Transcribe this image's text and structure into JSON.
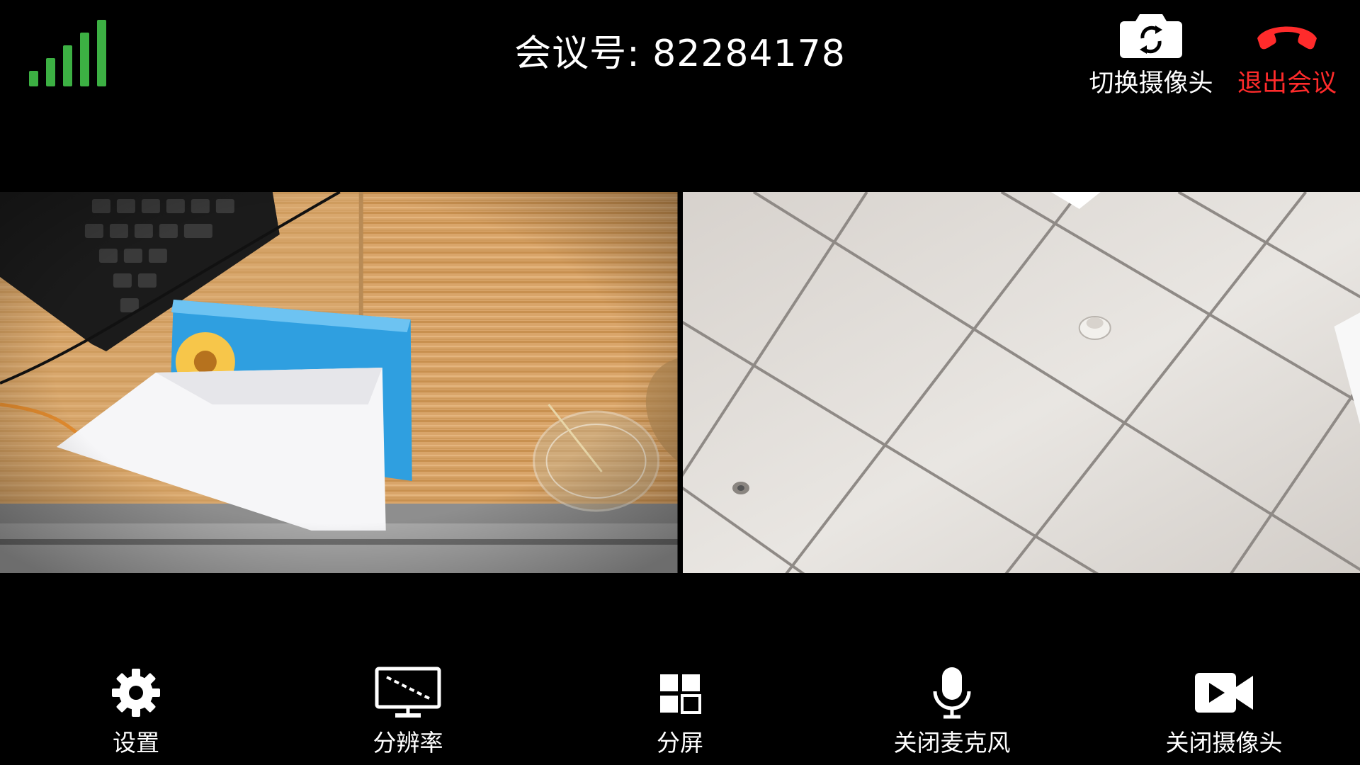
{
  "meeting": {
    "label": "会议号",
    "separator": ":",
    "number": "82284178",
    "display": "会议号: 82284178"
  },
  "signal": {
    "icon": "signal-strength-icon",
    "bars": 5,
    "color": "#3cb043"
  },
  "top_actions": {
    "switch_camera": {
      "label": "切换摄像头",
      "icon": "camera-switch-icon"
    },
    "leave_meeting": {
      "label": "退出会议",
      "icon": "hang-up-icon",
      "color": "#ff2b2b"
    }
  },
  "videos": [
    {
      "name": "local-video",
      "description_icon": "video-feed"
    },
    {
      "name": "remote-video",
      "description_icon": "video-feed"
    }
  ],
  "toolbar": {
    "settings": {
      "label": "设置",
      "icon": "gear-icon"
    },
    "resolution": {
      "label": "分辨率",
      "icon": "monitor-icon"
    },
    "split_screen": {
      "label": "分屏",
      "icon": "grid-icon"
    },
    "mute_mic": {
      "label": "关闭麦克风",
      "icon": "microphone-icon"
    },
    "close_camera": {
      "label": "关闭摄像头",
      "icon": "video-camera-icon"
    }
  }
}
